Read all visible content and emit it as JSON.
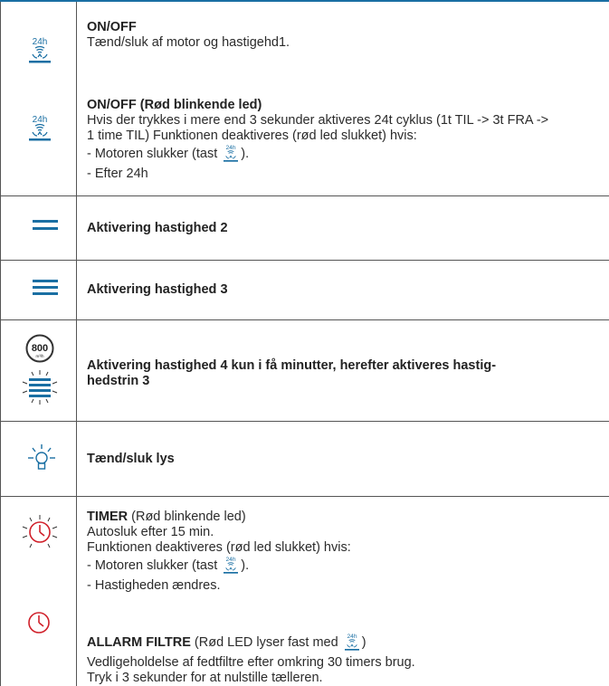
{
  "rows": {
    "onoff": {
      "title": "ON/OFF",
      "text": "Tænd/sluk af motor og hastigehd1.",
      "icon": "24h-fan-button-icon"
    },
    "onoff_red": {
      "title": "ON/OFF (Rød blinkende led)",
      "line1": "Hvis der trykkes i mere end 3 sekunder aktiveres 24t cyklus (1t TIL -> 3t FRA ->",
      "line2": "1 time TIL) Funktionen deaktiveres (rød led slukket) hvis:",
      "line3_pre": "- Motoren slukker (tast ",
      "line3_post": ").",
      "line4": "- Efter 24h"
    },
    "speed2": {
      "title": "Aktivering hastighed 2"
    },
    "speed3": {
      "title": "Aktivering hastighed 3"
    },
    "speed4": {
      "badge": "800",
      "badge_unit": "m³/h",
      "line1": "Aktivering hastighed 4 kun i få minutter, herefter aktiveres hastig-",
      "line2": "hedstrin 3"
    },
    "light": {
      "title": "Tænd/sluk lys"
    },
    "timer": {
      "title": "TIMER",
      "title_suffix": " (Rød blinkende led)",
      "line1": "Autosluk efter 15 min.",
      "line2": "Funktionen deaktiveres (rød led slukket) hvis:",
      "line3_pre": "- Motoren slukker (tast ",
      "line3_post": ").",
      "line4": "- Hastigheden ændres."
    },
    "filter": {
      "title": "ALLARM FILTRE",
      "title_suffix": "  (Rød LED lyser fast med ",
      "title_suffix_post": ")",
      "line1": "Vedligeholdelse af fedtfiltre efter omkring 30 timers brug.",
      "line2": "Tryk i 3 sekunder for at nulstille tælleren."
    }
  },
  "icon_label_24h": "24h",
  "colors": {
    "blue": "#1a6fa3",
    "red": "#d0202a",
    "text": "#2b2b2b",
    "rule": "#555555"
  }
}
